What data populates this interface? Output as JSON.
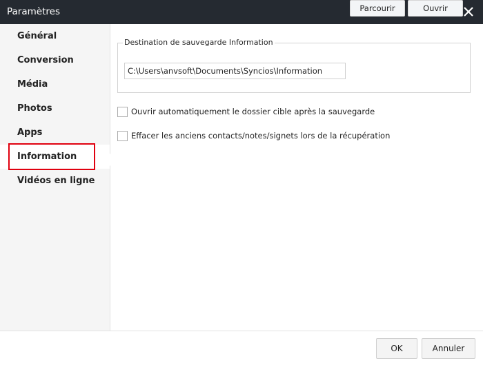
{
  "window": {
    "title": "Paramètres",
    "close_icon": "close-x-icon"
  },
  "sidebar": {
    "items": [
      {
        "label": "Général"
      },
      {
        "label": "Conversion"
      },
      {
        "label": "Média"
      },
      {
        "label": "Photos"
      },
      {
        "label": "Apps"
      },
      {
        "label": "Information",
        "selected": true
      },
      {
        "label": "Vidéos en ligne"
      }
    ],
    "highlight_color": "#e0000f"
  },
  "main": {
    "group_title": "Destination de sauvegarde Information",
    "path_value": "C:\\Users\\anvsoft\\Documents\\Syncios\\Information",
    "browse_label": "Parcourir",
    "open_label": "Ouvrir",
    "checkboxes": [
      {
        "label": "Ouvrir automatiquement le dossier cible après la sauvegarde",
        "checked": false
      },
      {
        "label": "Effacer les anciens contacts/notes/signets lors de la récupération",
        "checked": false
      }
    ]
  },
  "footer": {
    "ok_label": "OK",
    "cancel_label": "Annuler"
  }
}
